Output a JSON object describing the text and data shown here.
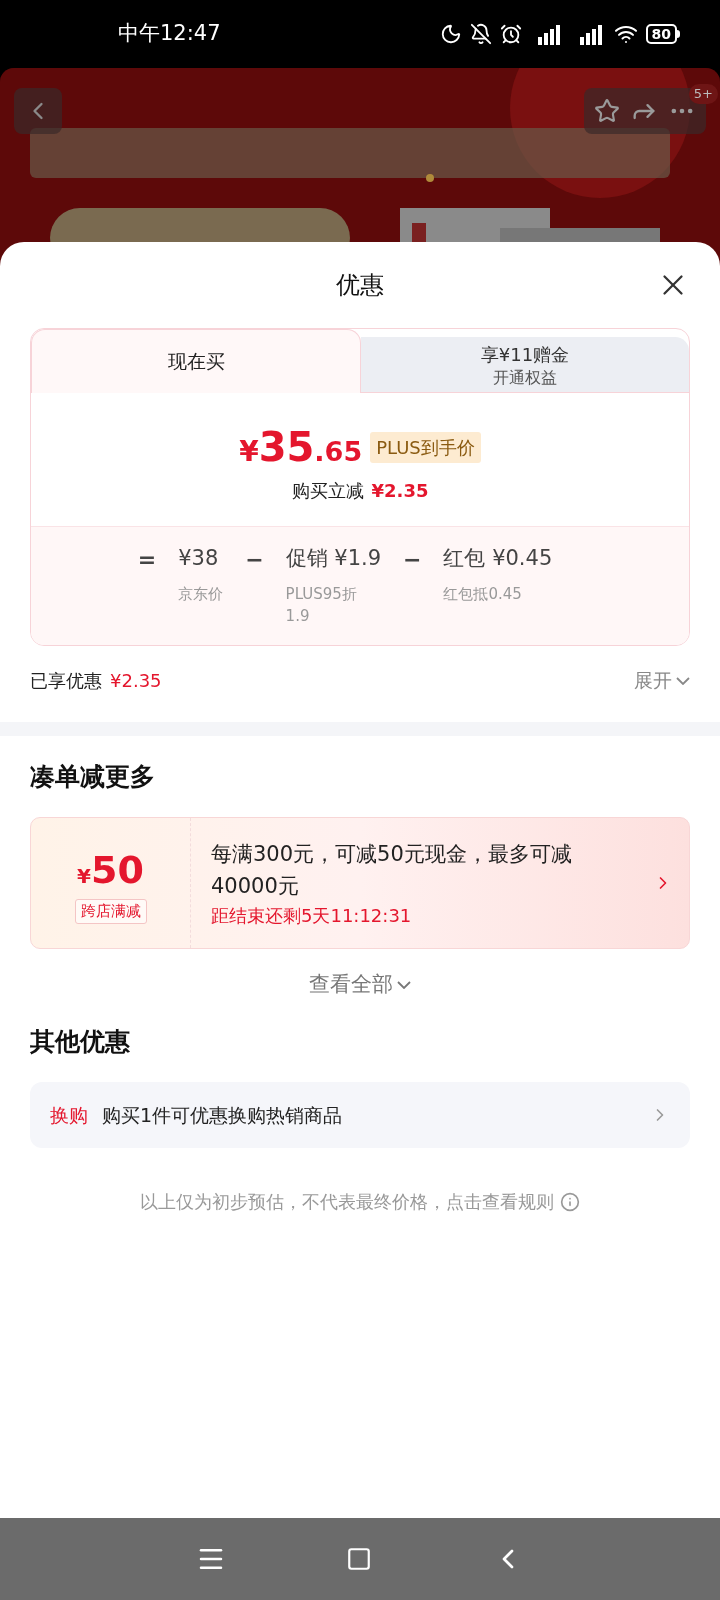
{
  "status_bar": {
    "time": "中午12:47",
    "battery": "80"
  },
  "header": {
    "badge": "5+"
  },
  "sheet": {
    "title": "优惠",
    "tabs": [
      {
        "label": "现在买",
        "selected": true
      },
      {
        "label": "享¥11赠金",
        "sublabel": "开通权益",
        "selected": false
      }
    ],
    "price": {
      "currency": "¥",
      "integer": "35",
      "decimal": ".65",
      "tag": "PLUS到手价",
      "saving_label": "购买立减",
      "saving": "¥2.35"
    },
    "breakdown": [
      {
        "operator": "=",
        "value": "¥38",
        "note": "京东价"
      },
      {
        "operator": "−",
        "value": "促销 ¥1.9",
        "note": "PLUS95折1.9"
      },
      {
        "operator": "−",
        "value": "红包 ¥0.45",
        "note": "红包抵0.45"
      }
    ],
    "summary": {
      "label": "已享优惠",
      "amount": "¥2.35",
      "expand": "展开"
    }
  },
  "bundle": {
    "title": "凑单减更多",
    "coupon": {
      "currency": "¥",
      "amount": "50",
      "tag": "跨店满减",
      "description": "每满300元，可减50元现金，最多可减40000元",
      "countdown": "距结束还剩5天11:12:31"
    },
    "see_all": "查看全部"
  },
  "other": {
    "title": "其他优惠",
    "items": [
      {
        "tag": "换购",
        "text": "购买1件可优惠换购热销商品"
      }
    ]
  },
  "disclaimer": "以上仅为初步预估，不代表最终价格，点击查看规则"
}
